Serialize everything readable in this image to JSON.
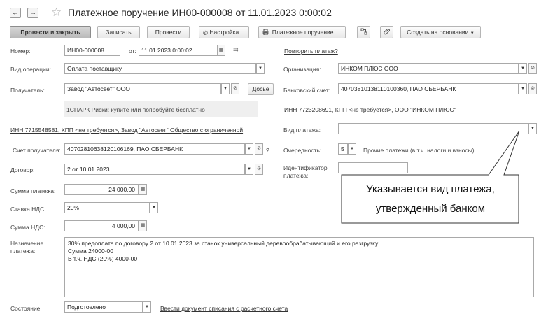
{
  "window": {
    "title": "Платежное поручение ИН00-000008 от 11.01.2023 0:00:02",
    "back_icon": "←",
    "forward_icon": "→",
    "star_icon": "☆"
  },
  "toolbar": {
    "post_close": "Провести и закрыть",
    "save": "Записать",
    "post": "Провести",
    "settings": "Настройка",
    "print_order": "Платежное поручение",
    "create_based": "Создать на основании"
  },
  "form": {
    "number_label": "Номер:",
    "number_value": "ИН00-000008",
    "date_label": "от:",
    "date_value": "11.01.2023  0:00:02",
    "repeat_link": "Повторить платеж?",
    "operation_label": "Вид операции:",
    "operation_value": "Оплата поставщику",
    "org_label": "Организация:",
    "org_value": "ИНКОМ ПЛЮС ООО",
    "recipient_label": "Получатель:",
    "recipient_value": "Завод \"Автосвет\" ООО",
    "dossier_button": "Досье",
    "bank_account_label": "Банковский счет:",
    "bank_account_value": "40703810138110100360, ПАО СБЕРБАНК",
    "spark_prefix": "1СПАРК Риски:",
    "spark_buy": "купите",
    "spark_or": "или",
    "spark_try": "попробуйте бесплатно",
    "payer_inn_link": "ИНН 7723208691, КПП <не требуется>, ООО \"ИНКОМ ПЛЮС\"",
    "recipient_inn_link": "ИНН 7715548581, КПП <не требуется>, Завод \"Автосвет\" Общество с ограниченной",
    "payment_type_label": "Вид платежа:",
    "payment_type_value": "",
    "recipient_account_label": "Счет получателя:",
    "recipient_account_value": "40702810638120106169, ПАО СБЕРБАНК",
    "question_mark": "?",
    "priority_label": "Очередность:",
    "priority_value": "5",
    "priority_desc": "Прочие платежи (в т.ч. налоги и взносы)",
    "contract_label": "Договор:",
    "contract_value": "2 от 10.01.2023",
    "identifier_label_1": "Идентификатор",
    "identifier_label_2": "платежа:",
    "amount_label": "Сумма платежа:",
    "amount_value": "24 000,00",
    "vat_rate_label": "Ставка НДС:",
    "vat_rate_value": "20%",
    "vat_amount_label": "Сумма НДС:",
    "vat_amount_value": "4 000,00",
    "purpose_label_1": "Назначение",
    "purpose_label_2": "платежа:",
    "purpose_line_1": "30% предоплата по договору 2 от 10.01.2023 за станок универсальный деревообрабатывающий и его разгрузку.",
    "purpose_line_2": "Сумма 24000-00",
    "purpose_line_3": "В т.ч. НДС  (20%) 4000-00",
    "status_label": "Состояние:",
    "status_value": "Подготовлено",
    "status_link": "Ввести документ списания с расчетного счета"
  },
  "callout": {
    "line_1": "Указывается вид платежа,",
    "line_2": "утвержденный банком"
  }
}
